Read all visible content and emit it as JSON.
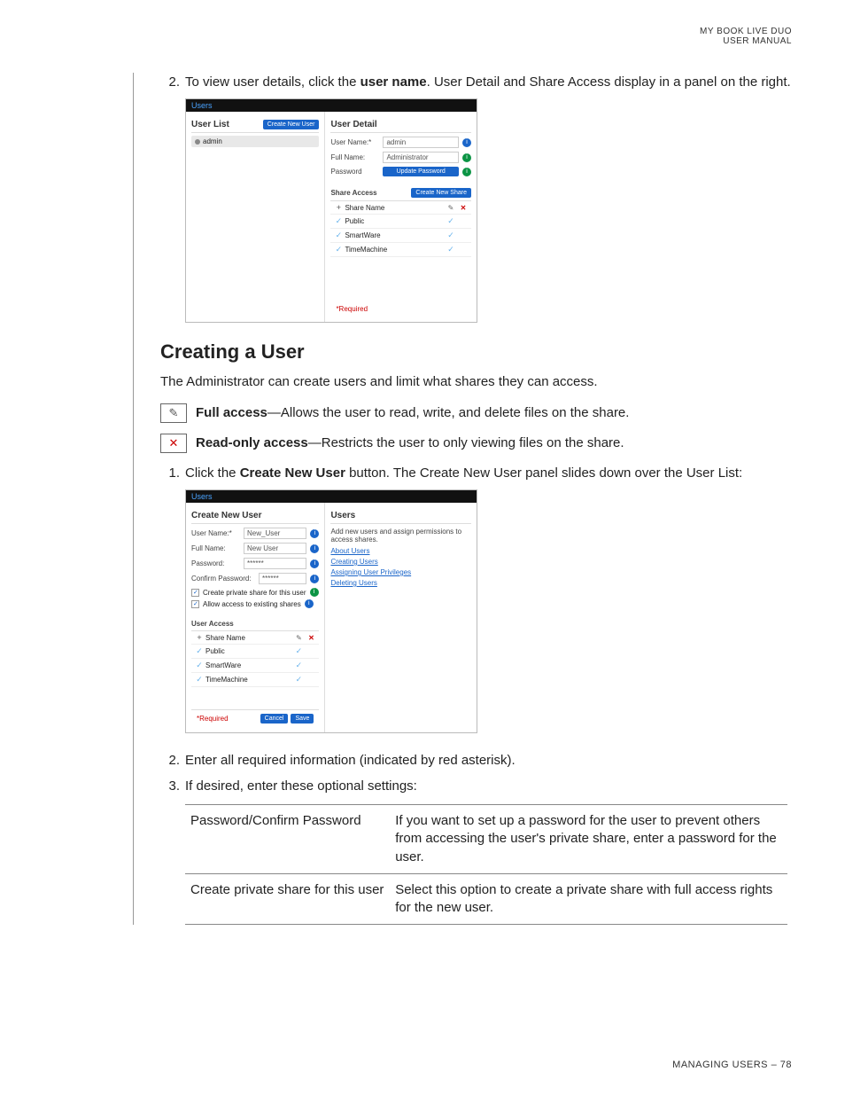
{
  "header": {
    "line1": "MY BOOK LIVE DUO",
    "line2": "USER MANUAL"
  },
  "step2_prefix": "To view user details, click the ",
  "step2_bold": "user name",
  "step2_suffix": ". User Detail and Share Access display in a panel on the right.",
  "ss1": {
    "topbar": "Users",
    "userlist_title": "User List",
    "create_user_btn": "Create New User",
    "admin_item": "admin",
    "userdetail_title": "User Detail",
    "username_label": "User Name:*",
    "username_val": "admin",
    "fullname_label": "Full Name:",
    "fullname_val": "Administrator",
    "password_label": "Password",
    "update_pw_btn": "Update Password",
    "share_access_title": "Share Access",
    "create_share_btn": "Create New Share",
    "col_sharename": "Share Name",
    "rows": [
      "Public",
      "SmartWare",
      "TimeMachine"
    ],
    "required": "*Required"
  },
  "section_title": "Creating a User",
  "intro_para": "The Administrator can create users and limit what shares they can access.",
  "full_access_label": "Full access",
  "full_access_desc": "—Allows the user to read, write, and delete files on the share.",
  "readonly_label": "Read-only access",
  "readonly_desc": "—Restricts the user to only viewing files on the share.",
  "step1_prefix": "Click the ",
  "step1_bold": "Create New User",
  "step1_suffix": " button. The Create New User panel slides down over the User List:",
  "ss2": {
    "topbar": "Users",
    "panel_title": "Create New User",
    "username_label": "User Name:*",
    "username_val": "New_User",
    "fullname_label": "Full Name:",
    "fullname_val": "New User",
    "password_label": "Password:",
    "password_val": "******",
    "confirm_label": "Confirm Password:",
    "confirm_val": "******",
    "chk_private": "Create private share for this user",
    "chk_allow": "Allow access to existing shares",
    "user_access_title": "User Access",
    "col_sharename": "Share Name",
    "rows": [
      "Public",
      "SmartWare",
      "TimeMachine"
    ],
    "required": "*Required",
    "cancel_btn": "Cancel",
    "save_btn": "Save",
    "help_title": "Users",
    "help_text": "Add new users and assign permissions to access shares.",
    "help_links": [
      "About Users",
      "Creating Users",
      "Assigning User Privileges",
      "Deleting Users"
    ]
  },
  "step2b": "Enter all required information (indicated by red asterisk).",
  "step3": "If desired, enter these optional settings:",
  "options": [
    {
      "label": "Password/Confirm Password",
      "desc": "If you want to set up a password for the user to prevent others from accessing the user's private share, enter a password for the user."
    },
    {
      "label": "Create private share for this user",
      "desc": "Select this option to create a private share with full access rights for the new user."
    }
  ],
  "footer": "MANAGING USERS – 78"
}
